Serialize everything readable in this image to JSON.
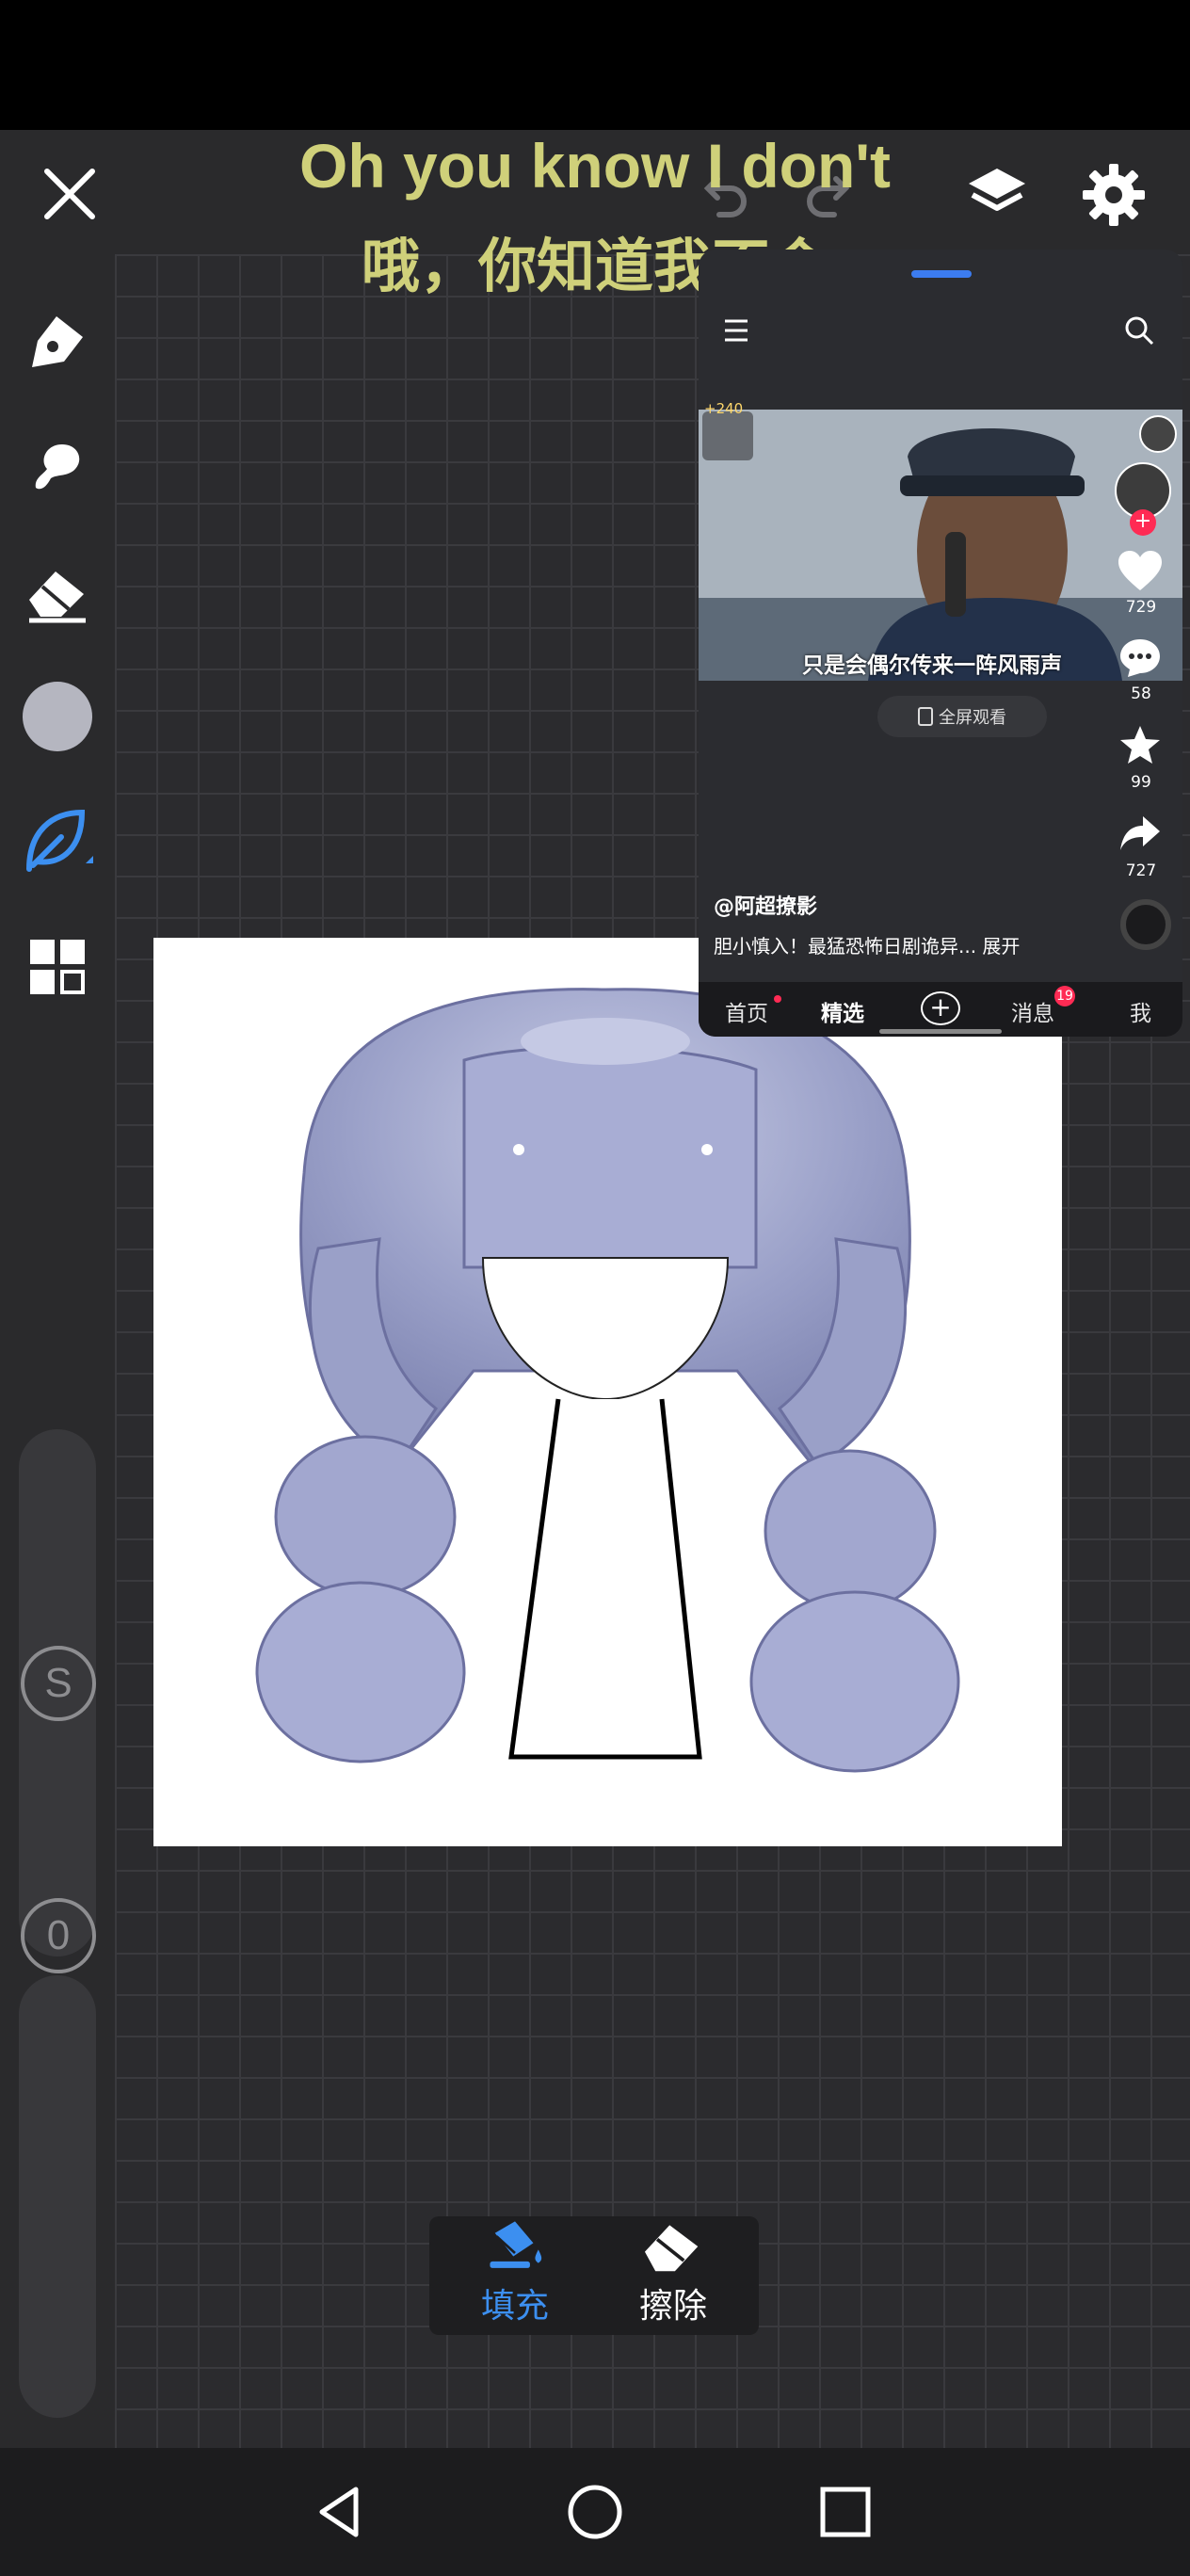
{
  "subtitles": {
    "english": "Oh you know I don't",
    "chinese": "哦，你知道我不会"
  },
  "toolbar": {
    "close_icon": "close-icon",
    "undo_icon": "undo-icon",
    "redo_icon": "redo-icon",
    "layers_icon": "layers-icon",
    "settings_icon": "gear-icon"
  },
  "left_tools": [
    "pen-icon",
    "smudge-brush-icon",
    "eraser-icon",
    "color-swatch",
    "lasso-leaf-icon",
    "grid-apps-icon"
  ],
  "colors": {
    "accent": "#3c8ff0",
    "swatch": "#b5b6c0",
    "subtitle": "#cfd07a",
    "badge": "#ff2b54"
  },
  "sliders": {
    "size_label": "S",
    "opacity_label": "0"
  },
  "fill_panel": {
    "fill_label": "填充",
    "erase_label": "擦除"
  },
  "floating_video": {
    "menu_icon": "menu-icon",
    "search_icon": "search-icon",
    "small_badge": "+240",
    "caption": "只是会偶尔传来一阵风雨声",
    "fullscreen_label": "全屏观看",
    "author": "@阿超撩影",
    "description": "胆小慎入！最猛恐怖日剧诡异... 展开",
    "likes": "729",
    "comments": "58",
    "favorites": "99",
    "shares": "727",
    "tabs": [
      "首页",
      "精选",
      "消息",
      "我"
    ],
    "message_badge": "19"
  },
  "nav": [
    "back-icon",
    "home-icon",
    "recents-icon"
  ]
}
